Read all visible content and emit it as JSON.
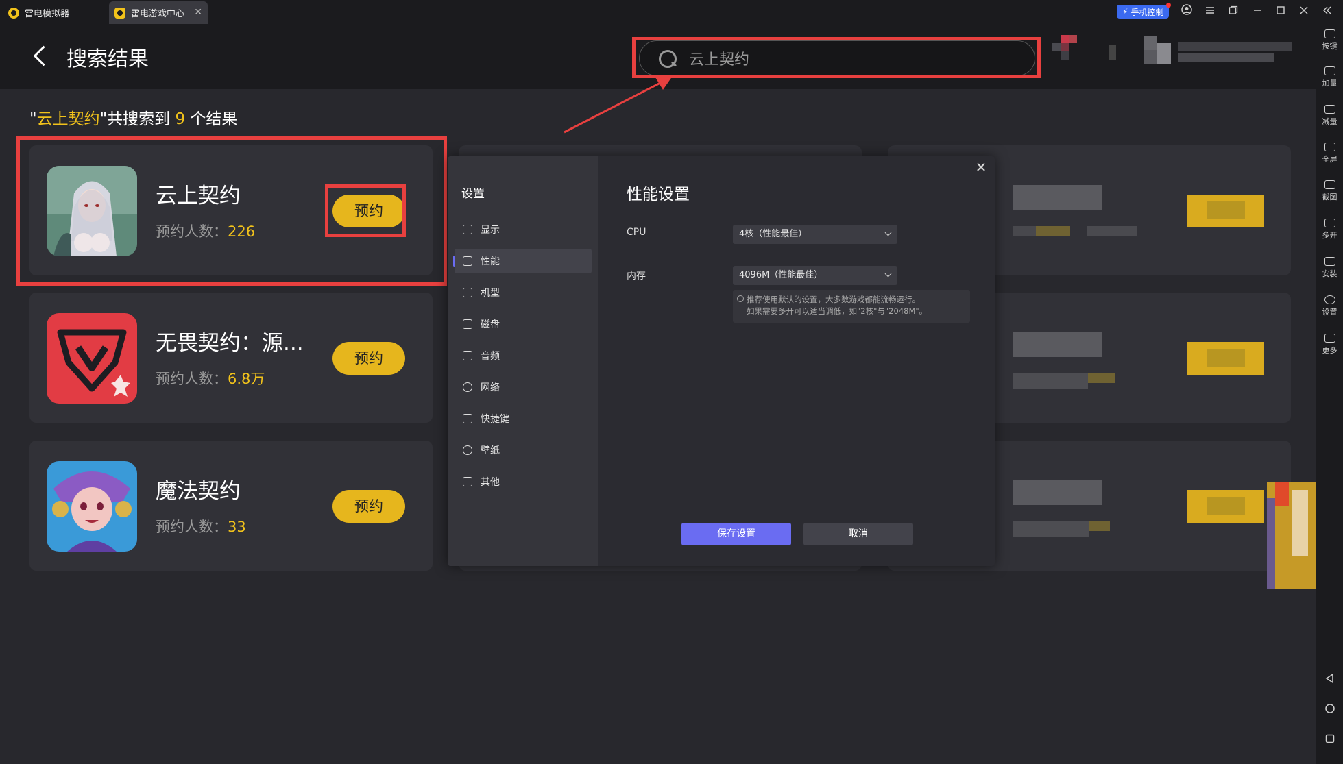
{
  "titlebar": {
    "tabs": [
      {
        "label": "雷电模拟器"
      },
      {
        "label": "雷电游戏中心"
      }
    ],
    "close_glyph": "✕",
    "phone_control": "手机控制",
    "window_icons": [
      "user-icon",
      "menu-icon",
      "restore-icon",
      "minimize-icon",
      "maximize-icon",
      "close-icon",
      "collapse-icon"
    ]
  },
  "header": {
    "title": "搜索结果",
    "search": {
      "value": "云上契约",
      "placeholder": "云上契约"
    }
  },
  "results": {
    "quote_open": "\"",
    "query": "云上契约",
    "text_mid": "\"共搜索到 ",
    "count": "9",
    "text_end": " 个结果"
  },
  "cards": [
    {
      "title": "云上契约",
      "sub_label": "预约人数：",
      "count": "226",
      "button": "预约"
    },
    {
      "title": "无畏契约：源...",
      "sub_label": "预约人数：",
      "count": "6.8万",
      "button": "预约"
    },
    {
      "title": "魔法契约",
      "sub_label": "预约人数：",
      "count": "33",
      "button": "预约"
    }
  ],
  "settings": {
    "side_title": "设置",
    "nav": [
      {
        "label": "显示",
        "icon": "display-icon"
      },
      {
        "label": "性能",
        "icon": "performance-icon"
      },
      {
        "label": "机型",
        "icon": "device-icon"
      },
      {
        "label": "磁盘",
        "icon": "disk-icon"
      },
      {
        "label": "音频",
        "icon": "audio-icon"
      },
      {
        "label": "网络",
        "icon": "network-icon"
      },
      {
        "label": "快捷键",
        "icon": "keyboard-icon"
      },
      {
        "label": "壁纸",
        "icon": "wallpaper-icon"
      },
      {
        "label": "其他",
        "icon": "other-icon"
      }
    ],
    "active": "性能",
    "heading": "性能设置",
    "cpu_label": "CPU",
    "cpu_value": "4核（性能最佳）",
    "mem_label": "内存",
    "mem_value": "4096M（性能最佳）",
    "hint_line1": "推荐使用默认的设置，大多数游戏都能流畅运行。",
    "hint_line2": "如果需要多开可以适当调低，如\"2核\"与\"2048M\"。",
    "save": "保存设置",
    "cancel": "取消",
    "close_glyph": "✕"
  },
  "rightbar": {
    "items": [
      "按键",
      "加量",
      "减量",
      "全屏",
      "截图",
      "多开",
      "安装",
      "设置",
      "更多"
    ]
  },
  "colors": {
    "accent": "#f1c21b",
    "button": "#e6b61d",
    "primary": "#6a6cf2",
    "annotation": "#e8403f",
    "phone_control": "#3b6af0"
  }
}
